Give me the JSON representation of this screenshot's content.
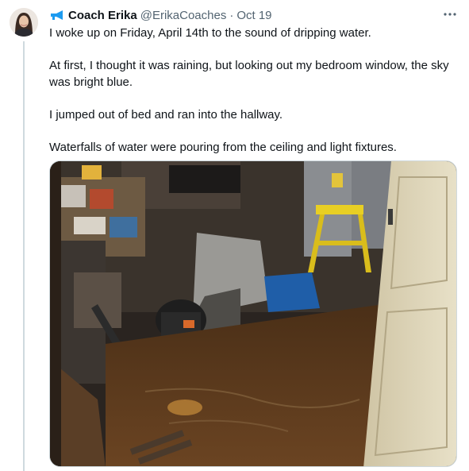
{
  "tweet": {
    "display_name": "Coach Erika",
    "handle": "@ErikaCoaches",
    "separator": "·",
    "date": "Oct 19",
    "name_icon": "megaphone-icon",
    "more_label": "···",
    "paragraphs": [
      "I woke up on Friday, April 14th to the sound of dripping water.",
      "At first, I thought it was raining, but looking out my bedroom window, the sky was bright blue.",
      "I jumped out of bed and ran into the hallway.",
      "Waterfalls of water were pouring from the ceiling and light fixtures."
    ],
    "media_alt": "Flooded basement with items in water"
  },
  "colors": {
    "text": "#0f1419",
    "secondary": "#536471",
    "border": "#cfd9de",
    "accent": "#1d9bf0",
    "floodwater": "#5a3a1c"
  }
}
